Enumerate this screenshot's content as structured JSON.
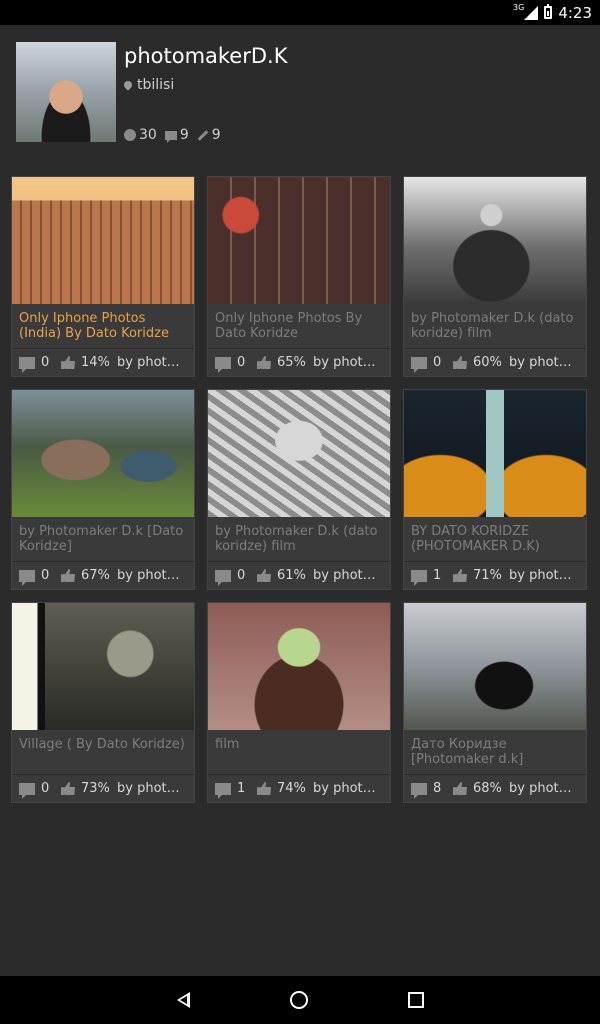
{
  "status_bar": {
    "network": "3G",
    "time": "4:23"
  },
  "profile": {
    "name": "photomakerD.K",
    "location": "tbilisi",
    "stats": {
      "photos": "30",
      "comments": "9",
      "edits": "9"
    }
  },
  "cards": [
    {
      "title": "Only Iphone Photos (India) By Dato Koridze",
      "comments": "0",
      "likes": "14%",
      "author": "by photomaker",
      "highlight": true
    },
    {
      "title": "Only Iphone Photos By Dato Koridze",
      "comments": "0",
      "likes": "65%",
      "author": "by photomaker"
    },
    {
      "title": "by Photomaker D.k (dato koridze) film",
      "comments": "0",
      "likes": "60%",
      "author": "by photomaker"
    },
    {
      "title": "by Photomaker D.k [Dato Koridze]",
      "comments": "0",
      "likes": "67%",
      "author": "by photomaker"
    },
    {
      "title": "by Photomaker D.k (dato koridze) film",
      "comments": "0",
      "likes": "61%",
      "author": "by photomaker"
    },
    {
      "title": "BY DATO KORIDZE (PHOTOMAKER D.K)",
      "comments": "1",
      "likes": "71%",
      "author": "by photomaker"
    },
    {
      "title": "Village ( By Dato Koridze)",
      "comments": "0",
      "likes": "73%",
      "author": "by photomaker"
    },
    {
      "title": "film",
      "comments": "1",
      "likes": "74%",
      "author": "by photomaker"
    },
    {
      "title": "Дато Коридзе [Photomaker d.k]",
      "comments": "8",
      "likes": "68%",
      "author": "by photomaker"
    }
  ]
}
